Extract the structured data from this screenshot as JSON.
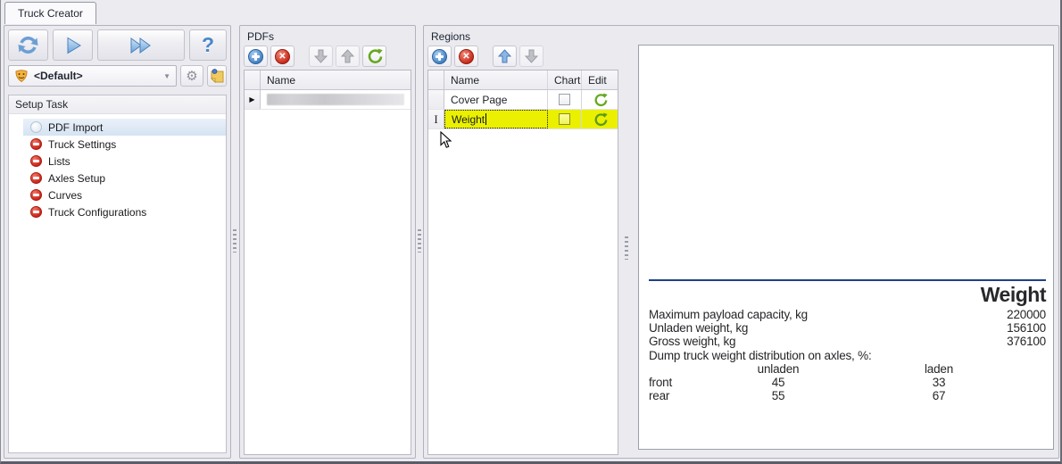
{
  "tab": {
    "label": "Truck Creator"
  },
  "left_panel": {
    "profile_value": "<Default>",
    "group_title": "Setup Task",
    "tasks": [
      {
        "label": "PDF Import"
      },
      {
        "label": "Truck Settings"
      },
      {
        "label": "Lists"
      },
      {
        "label": "Axles Setup"
      },
      {
        "label": "Curves"
      },
      {
        "label": "Truck Configurations"
      }
    ]
  },
  "pdfs_panel": {
    "title": "PDFs",
    "name_column": "Name"
  },
  "regions_panel": {
    "title": "Regions",
    "columns": {
      "name": "Name",
      "chart": "Chart",
      "edit": "Edit"
    },
    "rows": [
      {
        "name": "Cover Page",
        "chart_checked": false
      },
      {
        "name": "Weight",
        "chart_checked": false,
        "editing": true
      }
    ]
  },
  "preview": {
    "title": "Weight",
    "specs": [
      {
        "label": "Maximum payload capacity, kg",
        "value": "220000"
      },
      {
        "label": "Unladen weight, kg",
        "value": "156100"
      },
      {
        "label": "Gross weight, kg",
        "value": "376100"
      }
    ],
    "distribution": {
      "caption": "Dump truck weight distribution on axles, %:",
      "headers": [
        "unladen",
        "laden"
      ],
      "rows": [
        {
          "label": "front",
          "unladen": "45",
          "laden": "33"
        },
        {
          "label": "rear",
          "unladen": "55",
          "laden": "67"
        }
      ]
    }
  },
  "icons": {
    "help": "?",
    "combo_arrow": "▼",
    "gear": "⚙",
    "delete_x": "✕",
    "row_selector": "▶",
    "ibeam": "I"
  },
  "colors": {
    "edit_highlight": "#eaf000",
    "accent_blue": "#4a86c8",
    "rule_blue": "#1c4186",
    "danger_red": "#c22414",
    "success_green": "#66a81e"
  }
}
